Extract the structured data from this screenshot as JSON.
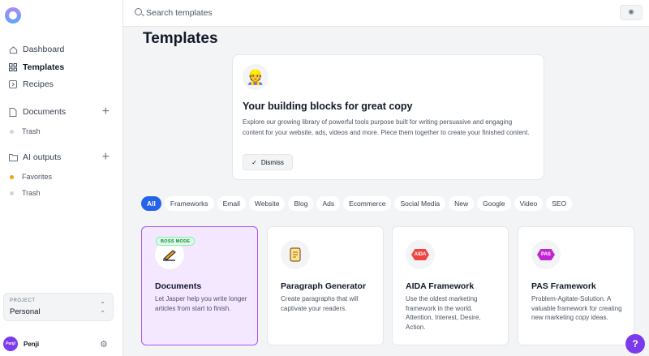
{
  "sidebar": {
    "nav": [
      {
        "label": "Dashboard",
        "icon": "home-icon"
      },
      {
        "label": "Templates",
        "icon": "grid-icon"
      },
      {
        "label": "Recipes",
        "icon": "recipe-icon"
      }
    ],
    "documents_label": "Documents",
    "documents_trash": "Trash",
    "ai_outputs_label": "AI outputs",
    "favorites_label": "Favorites",
    "ai_trash": "Trash",
    "project_label": "PROJECT",
    "project_value": "Personal",
    "user_name": "Penji",
    "avatar_text": "Penji"
  },
  "topbar": {
    "search_placeholder": "Search templates"
  },
  "page_title": "Templates",
  "welcome": {
    "heading": "Your building blocks for great copy",
    "body": "Explore our growing library of powerful tools purpose built for writing persuasive and engaging content for your website, ads, videos and more. Piece them together to create your finished content.",
    "dismiss_label": "Dismiss"
  },
  "filters": [
    "All",
    "Frameworks",
    "Email",
    "Website",
    "Blog",
    "Ads",
    "Ecommerce",
    "Social Media",
    "New",
    "Google",
    "Video",
    "SEO"
  ],
  "cards": [
    {
      "title": "Documents",
      "desc": "Let Jasper help you write longer articles from start to finish.",
      "badge": "BOSS MODE",
      "icon": "pencil-icon"
    },
    {
      "title": "Paragraph Generator",
      "desc": "Create paragraphs that will captivate your readers.",
      "icon": "scroll-icon"
    },
    {
      "title": "AIDA Framework",
      "desc": "Use the oldest marketing framework in the world. Attention, Interest, Desire, Action.",
      "icon_text": "AIDA",
      "icon": "aida-icon"
    },
    {
      "title": "PAS Framework",
      "desc": "Problem-Agitate-Solution. A valuable framework for creating new marketing copy ideas.",
      "icon_text": "PAS",
      "icon": "pas-icon"
    }
  ],
  "colors": {
    "accent": "#2563eb",
    "highlight_border": "#a855f7",
    "help_button": "#7c3aed"
  }
}
